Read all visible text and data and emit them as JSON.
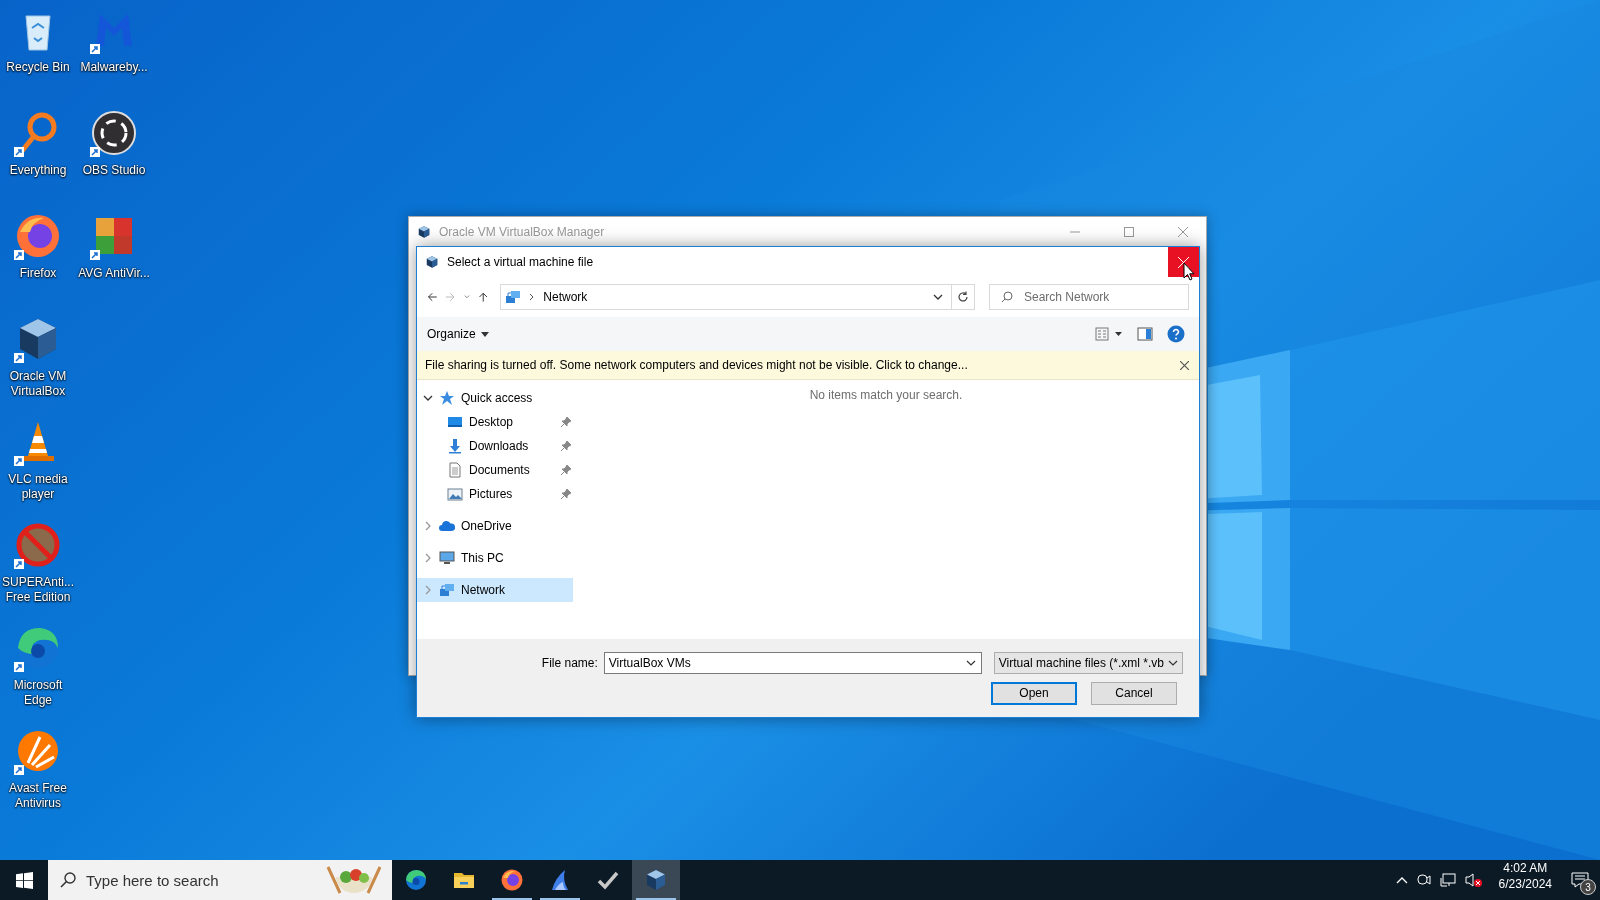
{
  "desktop_icons": [
    {
      "label": "Recycle Bin",
      "kind": "bin",
      "shortcut": false
    },
    {
      "label": "Everything",
      "kind": "magnifier",
      "shortcut": true
    },
    {
      "label": "Firefox",
      "kind": "firefox",
      "shortcut": true
    },
    {
      "label": "Oracle VM VirtualBox",
      "kind": "cube",
      "shortcut": true
    },
    {
      "label": "VLC media player",
      "kind": "cone",
      "shortcut": true
    },
    {
      "label": "SUPERAnti... Free Edition",
      "kind": "prohibited",
      "shortcut": true
    },
    {
      "label": "Microsoft Edge",
      "kind": "edge",
      "shortcut": true
    },
    {
      "label": "Avast Free Antivirus",
      "kind": "avast",
      "shortcut": true
    },
    {
      "label": "Malwareby...",
      "kind": "mlogo",
      "shortcut": true
    },
    {
      "label": "OBS Studio",
      "kind": "obs",
      "shortcut": true
    },
    {
      "label": "AVG AntiVir...",
      "kind": "avg",
      "shortcut": true
    }
  ],
  "background_window": {
    "title": "Oracle VM VirtualBox Manager",
    "active": false
  },
  "dialog": {
    "title": "Select a virtual machine file",
    "close_hovered": true,
    "address": "Network",
    "search": {
      "placeholder": "Search Network"
    },
    "organize": "Organize",
    "info_bar": "File sharing is turned off. Some network computers and devices might not be visible. Click to change...",
    "nav_tree": [
      {
        "label": "Quick access",
        "kind": "star",
        "expanded": true,
        "selected": false,
        "children": [
          {
            "label": "Desktop",
            "kind": "desktop",
            "pinned": true,
            "selected": false
          },
          {
            "label": "Downloads",
            "kind": "download",
            "pinned": true,
            "selected": false
          },
          {
            "label": "Documents",
            "kind": "document",
            "pinned": true,
            "selected": false
          },
          {
            "label": "Pictures",
            "kind": "pictures",
            "pinned": true,
            "selected": false
          }
        ]
      },
      {
        "label": "OneDrive",
        "kind": "cloud",
        "expanded": false,
        "selected": false
      },
      {
        "label": "This PC",
        "kind": "monitor",
        "expanded": false,
        "selected": false
      },
      {
        "label": "Network",
        "kind": "network",
        "expanded": false,
        "selected": true
      }
    ],
    "empty_message": "No items match your search.",
    "file_name": {
      "label": "File name:",
      "value": "VirtualBox VMs"
    },
    "file_type": "Virtual machine files (*.xml *.vb",
    "buttons": [
      {
        "label": "Open",
        "default": true
      },
      {
        "label": "Cancel",
        "default": false
      }
    ]
  },
  "taskbar": {
    "search_placeholder": "Type here to search",
    "apps": [
      {
        "kind": "edge",
        "running": false,
        "active": false
      },
      {
        "kind": "folder",
        "running": false,
        "active": false
      },
      {
        "kind": "firefox",
        "running": true,
        "active": false
      },
      {
        "kind": "shark",
        "running": true,
        "active": false
      },
      {
        "kind": "check",
        "running": false,
        "active": false
      },
      {
        "kind": "cube",
        "running": true,
        "active": true
      }
    ],
    "clock": {
      "time": "4:02 AM",
      "date": "6/23/2024"
    },
    "notifications": "3"
  }
}
